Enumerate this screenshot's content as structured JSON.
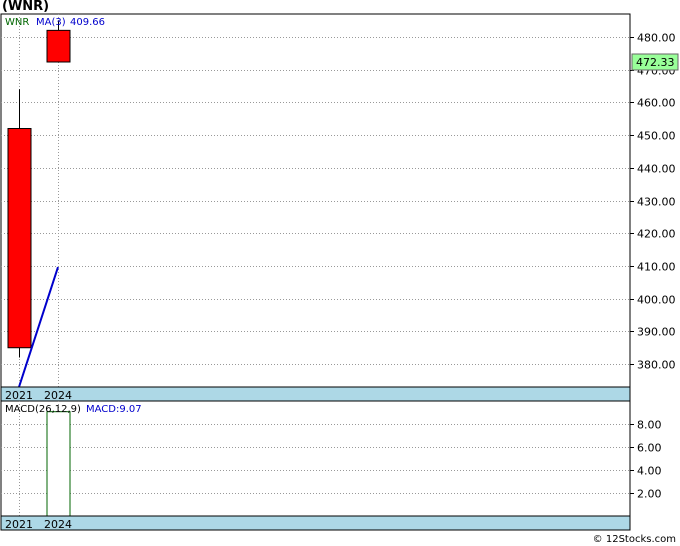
{
  "title": "(WNR)",
  "copyright": "© 12Stocks.com",
  "colors": {
    "up": "#ff0000",
    "ma": "#0000cc",
    "macd_bar": "#006600",
    "ticker_text": "#006600",
    "last_price_bg": "#99ff99",
    "axis_band": "#add8e6",
    "grid": "#999999"
  },
  "chart_data": [
    {
      "type": "candlestick",
      "ticker": "WNR",
      "ma_label": "MA(3)",
      "ma_value_label": "409.66",
      "last_price_label": "472.33",
      "categories": [
        "2021",
        "2024"
      ],
      "candles": [
        {
          "x": "2021",
          "open": 385,
          "close": 452,
          "high": 464,
          "low": 382
        },
        {
          "x": "2024",
          "open": 472.33,
          "close": 482,
          "high": 485,
          "low": 472.33
        }
      ],
      "ma_series": [
        {
          "x": "2021",
          "y": 373
        },
        {
          "x": "2024",
          "y": 409.66
        }
      ],
      "y_ticks": [
        380,
        390,
        400,
        410,
        420,
        430,
        440,
        450,
        460,
        470,
        480
      ],
      "y_tick_labels": [
        "380.00",
        "390.00",
        "400.00",
        "410.00",
        "420.00",
        "430.00",
        "440.00",
        "450.00",
        "460.00",
        "470.00",
        "480.00"
      ],
      "ylim": [
        373,
        487
      ],
      "grid": true
    },
    {
      "type": "bar",
      "label": "MACD(26,12,9)",
      "value_label": "MACD:9.07",
      "categories": [
        "2021",
        "2024"
      ],
      "values": [
        null,
        9.07
      ],
      "y_ticks": [
        2,
        4,
        6,
        8
      ],
      "y_tick_labels": [
        "2.00",
        "4.00",
        "6.00",
        "8.00"
      ],
      "ylim": [
        0,
        10
      ],
      "grid": true
    }
  ]
}
